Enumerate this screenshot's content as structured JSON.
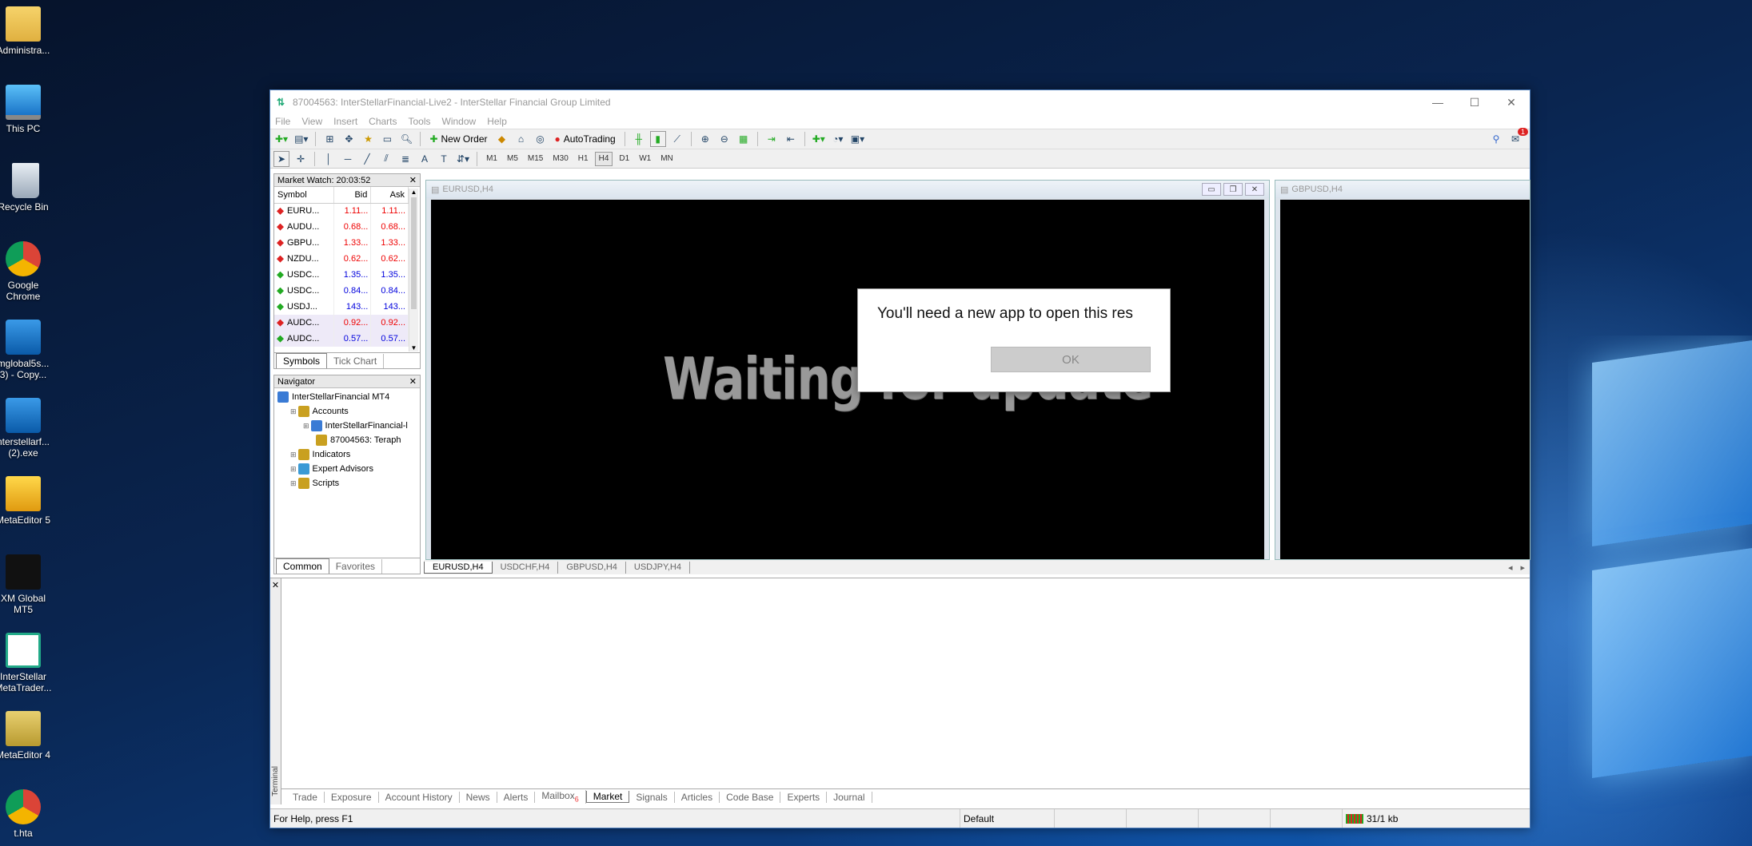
{
  "desktop": {
    "icons": [
      {
        "label1": "Administra...",
        "label2": "",
        "icon": "user-folder-icon"
      },
      {
        "label1": "This PC",
        "label2": "",
        "icon": "computer-icon"
      },
      {
        "label1": "Recycle Bin",
        "label2": "",
        "icon": "recycle-bin-icon"
      },
      {
        "label1": "Google",
        "label2": "Chrome",
        "icon": "chrome-icon"
      },
      {
        "label1": "mglobal5s...",
        "label2": "3) - Copy...",
        "icon": "installer-icon"
      },
      {
        "label1": "nterstellarf...",
        "label2": "(2).exe",
        "icon": "installer-icon"
      },
      {
        "label1": "MetaEditor 5",
        "label2": "",
        "icon": "metaeditor5-icon"
      },
      {
        "label1": "XM Global",
        "label2": "MT5",
        "icon": "xm-icon"
      },
      {
        "label1": "InterStellar",
        "label2": "MetaTrader...",
        "icon": "interstellar-icon"
      },
      {
        "label1": "MetaEditor 4",
        "label2": "",
        "icon": "metaeditor4-icon"
      },
      {
        "label1": "t.hta",
        "label2": "",
        "icon": "chrome-icon"
      }
    ]
  },
  "window": {
    "title": "87004563: InterStellarFinancial-Live2 - InterStellar Financial Group Limited",
    "menu": [
      "File",
      "View",
      "Insert",
      "Charts",
      "Tools",
      "Window",
      "Help"
    ],
    "toolbar": {
      "new_order": "New Order",
      "autotrading": "AutoTrading",
      "notification_count": "1"
    },
    "timeframes": [
      "M1",
      "M5",
      "M15",
      "M30",
      "H1",
      "H4",
      "D1",
      "W1",
      "MN"
    ],
    "selected_timeframe": "H4"
  },
  "market_watch": {
    "title": "Market Watch: 20:03:52",
    "columns": [
      "Symbol",
      "Bid",
      "Ask"
    ],
    "rows": [
      {
        "symbol": "EURU...",
        "bid": "1.11...",
        "ask": "1.11...",
        "dir": "down"
      },
      {
        "symbol": "AUDU...",
        "bid": "0.68...",
        "ask": "0.68...",
        "dir": "down"
      },
      {
        "symbol": "GBPU...",
        "bid": "1.33...",
        "ask": "1.33...",
        "dir": "down"
      },
      {
        "symbol": "NZDU...",
        "bid": "0.62...",
        "ask": "0.62...",
        "dir": "down"
      },
      {
        "symbol": "USDC...",
        "bid": "1.35...",
        "ask": "1.35...",
        "dir": "up"
      },
      {
        "symbol": "USDC...",
        "bid": "0.84...",
        "ask": "0.84...",
        "dir": "up"
      },
      {
        "symbol": "USDJ...",
        "bid": "143...",
        "ask": "143...",
        "dir": "up"
      },
      {
        "symbol": "AUDC...",
        "bid": "0.92...",
        "ask": "0.92...",
        "dir": "down"
      },
      {
        "symbol": "AUDC...",
        "bid": "0.57...",
        "ask": "0.57...",
        "dir": "up"
      }
    ],
    "tabs": [
      "Symbols",
      "Tick Chart"
    ]
  },
  "navigator": {
    "title": "Navigator",
    "tree": [
      {
        "label": "InterStellarFinancial MT4",
        "level": 0
      },
      {
        "label": "Accounts",
        "level": 1
      },
      {
        "label": "InterStellarFinancial-l",
        "level": 2
      },
      {
        "label": "87004563: Teraph",
        "level": 3
      },
      {
        "label": "Indicators",
        "level": 1
      },
      {
        "label": "Expert Advisors",
        "level": 1
      },
      {
        "label": "Scripts",
        "level": 1
      }
    ],
    "tabs": [
      "Common",
      "Favorites"
    ]
  },
  "charts": {
    "main_title": "EURUSD,H4",
    "side_title": "GBPUSD,H4",
    "overlay_text": "Waiting for update",
    "tabs": [
      "EURUSD,H4",
      "USDCHF,H4",
      "GBPUSD,H4",
      "USDJPY,H4"
    ]
  },
  "terminal": {
    "label": "Terminal",
    "tabs": [
      "Trade",
      "Exposure",
      "Account History",
      "News",
      "Alerts",
      "Mailbox",
      "Market",
      "Signals",
      "Articles",
      "Code Base",
      "Experts",
      "Journal"
    ],
    "mailbox_badge": "6",
    "active_tab": "Market"
  },
  "statusbar": {
    "help": "For Help, press F1",
    "profile": "Default",
    "traffic": "31/1 kb"
  },
  "dialog": {
    "message": "You'll need a new app to open this res",
    "ok": "OK"
  }
}
